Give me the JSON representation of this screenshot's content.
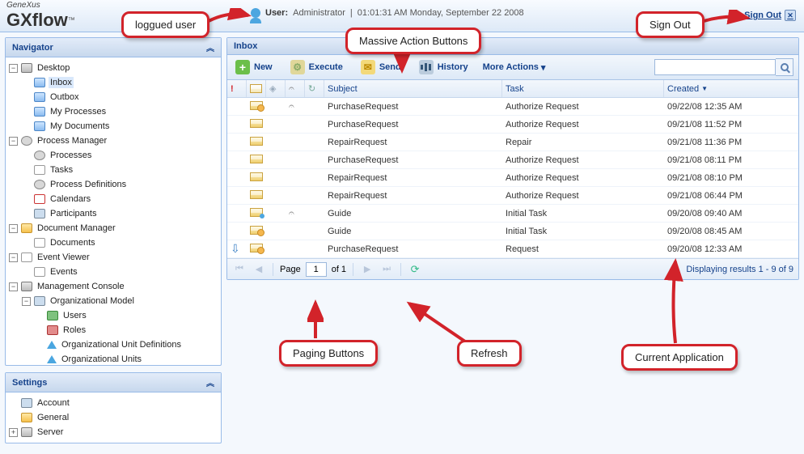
{
  "brand": {
    "top": "GeneXus",
    "main": "GXflow",
    "tm": "™"
  },
  "header": {
    "user_label": "User:",
    "user_name": "Administrator",
    "datetime": "01:01:31 AM Monday, September 22 2008",
    "signout": "Sign Out"
  },
  "navigator": {
    "title": "Navigator",
    "desktop": "Desktop",
    "inbox": "Inbox",
    "outbox": "Outbox",
    "my_processes": "My Processes",
    "my_documents": "My Documents",
    "process_manager": "Process Manager",
    "processes": "Processes",
    "tasks": "Tasks",
    "process_definitions": "Process Definitions",
    "calendars": "Calendars",
    "participants": "Participants",
    "document_manager": "Document Manager",
    "documents": "Documents",
    "event_viewer": "Event Viewer",
    "events": "Events",
    "management_console": "Management Console",
    "organizational_model": "Organizational Model",
    "users": "Users",
    "roles": "Roles",
    "org_unit_defs": "Organizational Unit Definitions",
    "org_units": "Organizational Units"
  },
  "settings": {
    "title": "Settings",
    "account": "Account",
    "general": "General",
    "server": "Server"
  },
  "inbox": {
    "title": "Inbox",
    "toolbar": {
      "new": "New",
      "execute": "Execute",
      "send": "Send",
      "history": "History",
      "more_actions": "More Actions"
    },
    "columns": {
      "priority": "!",
      "subject": "Subject",
      "task": "Task",
      "created": "Created"
    },
    "rows": [
      {
        "icon": "gear-corner",
        "clip": true,
        "subject": "PurchaseRequest",
        "task": "Authorize Request",
        "created": "09/22/08 12:35 AM"
      },
      {
        "icon": "plain",
        "subject": "PurchaseRequest",
        "task": "Authorize Request",
        "created": "09/21/08 11:52 PM"
      },
      {
        "icon": "plain",
        "subject": "RepairRequest",
        "task": "Repair",
        "created": "09/21/08 11:36 PM"
      },
      {
        "icon": "plain",
        "subject": "PurchaseRequest",
        "task": "Authorize Request",
        "created": "09/21/08 08:11 PM"
      },
      {
        "icon": "plain",
        "subject": "RepairRequest",
        "task": "Authorize Request",
        "created": "09/21/08 08:10 PM"
      },
      {
        "icon": "plain",
        "subject": "RepairRequest",
        "task": "Authorize Request",
        "created": "09/21/08 06:44 PM"
      },
      {
        "icon": "person",
        "clip": true,
        "subject": "Guide",
        "task": "Initial Task",
        "created": "09/20/08 09:40 AM"
      },
      {
        "icon": "gear-corner",
        "subject": "Guide",
        "task": "Initial Task",
        "created": "09/20/08 08:45 AM"
      },
      {
        "icon": "gear-corner",
        "priority": "low",
        "subject": "PurchaseRequest",
        "task": "Request",
        "created": "09/20/08 12:33 AM"
      }
    ],
    "pager": {
      "page_label": "Page",
      "page": "1",
      "of_label": "of 1",
      "display": "Displaying results 1 - 9 of 9"
    },
    "search_placeholder": ""
  },
  "callouts": {
    "loggued_user": "loggued user",
    "massive_actions": "Massive Action Buttons",
    "sign_out": "Sign Out",
    "paging": "Paging Buttons",
    "refresh": "Refresh",
    "current_app": "Current Application"
  }
}
